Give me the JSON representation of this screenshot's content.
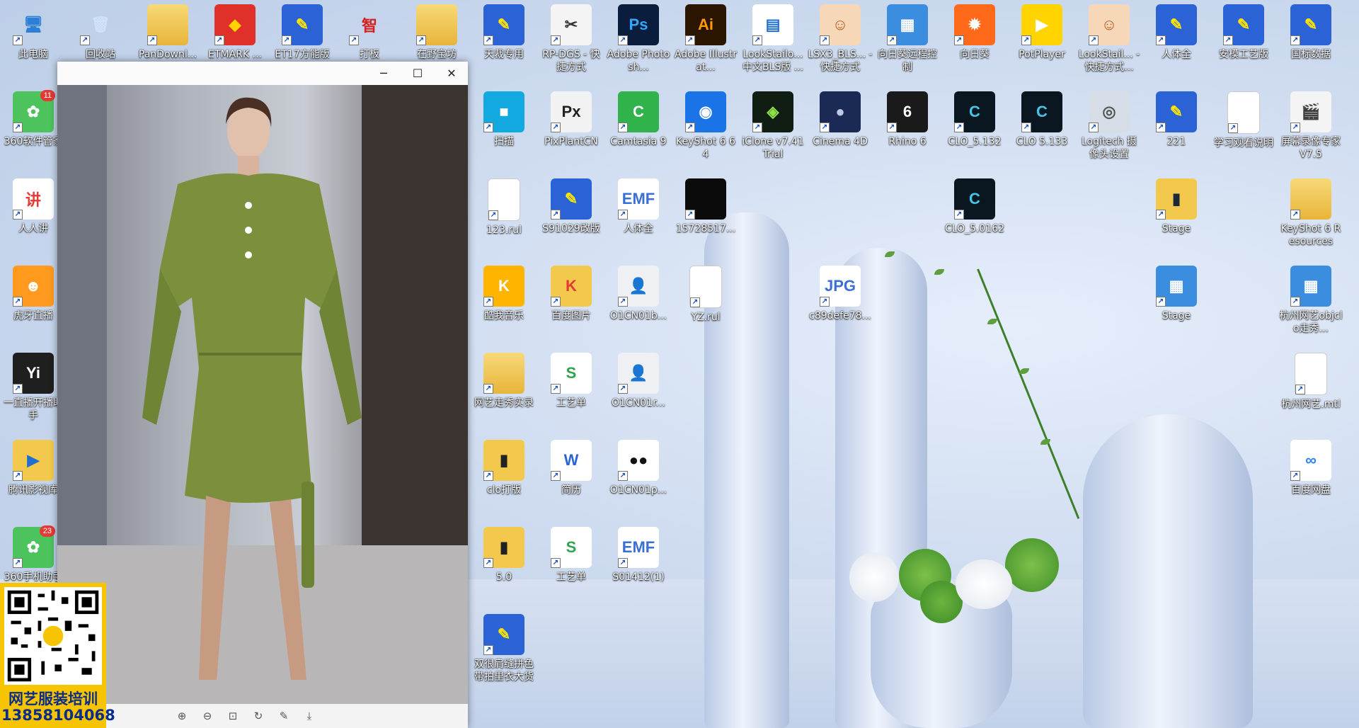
{
  "desktop": {
    "icons": [
      {
        "label": "此电脑",
        "glyph": "🖥",
        "bg": "#ffffff00",
        "fg": "#2d7fd6"
      },
      {
        "label": "回收站",
        "glyph": "🗑",
        "bg": "#ffffff00",
        "fg": "#cfe2f7"
      },
      {
        "label": "PanDownl...",
        "glyph": "",
        "bg": "#f2c94c",
        "fg": "#fff"
      },
      {
        "label": "ETMARK ...",
        "glyph": "◆",
        "bg": "#e0302a",
        "fg": "#ffd200"
      },
      {
        "label": "ET17方能版",
        "glyph": "✎",
        "bg": "#2b62d6",
        "fg": "#ffe600"
      },
      {
        "label": "打板",
        "glyph": "智",
        "bg": "#ffffff00",
        "fg": "#d81f1f"
      },
      {
        "label": "在野宝坊",
        "glyph": "",
        "bg": "#f2c94c",
        "fg": "#fff"
      },
      {
        "label": "天裁专用",
        "glyph": "✎",
        "bg": "#2b62d6",
        "fg": "#ffe600"
      },
      {
        "label": "RP-DGS - 快捷方式",
        "glyph": "✂",
        "bg": "#f4f4f4",
        "fg": "#333"
      },
      {
        "label": "Adobe Photosh...",
        "glyph": "Ps",
        "bg": "#0a1d3d",
        "fg": "#31a8ff"
      },
      {
        "label": "Adobe Illustrat...",
        "glyph": "Ai",
        "bg": "#2b1500",
        "fg": "#ff9a00"
      },
      {
        "label": "LookStailo... 中文BLS版 ...",
        "glyph": "▤",
        "bg": "#ffffff",
        "fg": "#1f6fd1"
      },
      {
        "label": "LSX3_BLS... - 快捷方式",
        "glyph": "☺",
        "bg": "#f6d7b8",
        "fg": "#b05a1c"
      },
      {
        "label": "向日葵远程控制",
        "glyph": "▦",
        "bg": "#3b8de0",
        "fg": "#fff"
      },
      {
        "label": "向日葵",
        "glyph": "✹",
        "bg": "#ff6a1a",
        "fg": "#fff"
      },
      {
        "label": "PotPlayer",
        "glyph": "▶",
        "bg": "#ffd400",
        "fg": "#fff"
      },
      {
        "label": "LookStail... - 快捷方式...",
        "glyph": "☺",
        "bg": "#f6d7b8",
        "fg": "#b05a1c"
      },
      {
        "label": "人体全",
        "glyph": "✎",
        "bg": "#2b62d6",
        "fg": "#ffe600"
      },
      {
        "label": "安模工艺版",
        "glyph": "✎",
        "bg": "#2b62d6",
        "fg": "#ffe600"
      },
      {
        "label": "国标数据",
        "glyph": "✎",
        "bg": "#2b62d6",
        "fg": "#ffe600"
      },
      {
        "label": "360软件管家",
        "glyph": "✿",
        "bg": "#4cc35d",
        "fg": "#fff",
        "badge": "11"
      },
      {
        "label": "扫描",
        "glyph": "■",
        "bg": "#12a9e0",
        "fg": "#fff"
      },
      {
        "label": "PixPlantCN",
        "glyph": "Px",
        "bg": "#f2f2f2",
        "fg": "#222"
      },
      {
        "label": "Camtasia 9",
        "glyph": "C",
        "bg": "#2fb34a",
        "fg": "#fff"
      },
      {
        "label": "KeyShot 6 64",
        "glyph": "◉",
        "bg": "#1b73e8",
        "fg": "#fff"
      },
      {
        "label": "iClone v7.41 Trial",
        "glyph": "◈",
        "bg": "#101d12",
        "fg": "#8ee34a"
      },
      {
        "label": "Cinema 4D",
        "glyph": "●",
        "bg": "#1b2a55",
        "fg": "#bfc9e6"
      },
      {
        "label": "Rhino 6",
        "glyph": "6",
        "bg": "#1a1a1a",
        "fg": "#fff"
      },
      {
        "label": "CLO_5.132",
        "glyph": "C",
        "bg": "#0a1720",
        "fg": "#44c6e8"
      },
      {
        "label": "CLO 5.133",
        "glyph": "C",
        "bg": "#0a1720",
        "fg": "#44c6e8"
      },
      {
        "label": "Logitech 摄像头设置",
        "glyph": "◎",
        "bg": "#d7dde6",
        "fg": "#555"
      },
      {
        "label": "221",
        "glyph": "✎",
        "bg": "#2b62d6",
        "fg": "#ffe600"
      },
      {
        "label": "学习观看说明",
        "glyph": "",
        "bg": "#ffffff",
        "fg": "#999"
      },
      {
        "label": "屏幕录像专家V7.5",
        "glyph": "🎬",
        "bg": "#f4f4f4",
        "fg": "#333"
      },
      {
        "label": "人人讲",
        "glyph": "讲",
        "bg": "#ffffff",
        "fg": "#e53935"
      },
      {
        "label": "123.rul",
        "glyph": "",
        "bg": "#ffffff",
        "fg": "#999"
      },
      {
        "label": "S91029改版",
        "glyph": "✎",
        "bg": "#2b62d6",
        "fg": "#ffe600"
      },
      {
        "label": "人体全",
        "glyph": "EMF",
        "bg": "#ffffff",
        "fg": "#3a6fd6"
      },
      {
        "label": "15728517...",
        "glyph": "",
        "bg": "#0b0b0b",
        "fg": "#fff"
      },
      {
        "label": "CLO_5.0162",
        "glyph": "C",
        "bg": "#0a1720",
        "fg": "#44c6e8"
      },
      {
        "label": "Stage",
        "glyph": "▮",
        "bg": "#f2c94c",
        "fg": "#1a2a3a"
      },
      {
        "label": "KeyShot 6 Resources",
        "glyph": "",
        "bg": "#f2c94c",
        "fg": "#fff"
      },
      {
        "label": "虎牙直播",
        "glyph": "☻",
        "bg": "#ff9a1f",
        "fg": "#fff"
      },
      {
        "label": "酷我音乐",
        "glyph": "K",
        "bg": "#ffb400",
        "fg": "#fff"
      },
      {
        "label": "百度图片",
        "glyph": "K",
        "bg": "#f2c94c",
        "fg": "#e53935"
      },
      {
        "label": "O1CN01b...",
        "glyph": "👤",
        "bg": "#eef0f3",
        "fg": "#666"
      },
      {
        "label": "YZ.rul",
        "glyph": "",
        "bg": "#ffffff",
        "fg": "#999"
      },
      {
        "label": "c89defe78...",
        "glyph": "JPG",
        "bg": "#ffffff",
        "fg": "#3a6fd6"
      },
      {
        "label": "Stage",
        "glyph": "▦",
        "bg": "#3b8de0",
        "fg": "#fff"
      },
      {
        "label": "杭州网艺objclo走秀...",
        "glyph": "▦",
        "bg": "#3b8de0",
        "fg": "#fff"
      },
      {
        "label": "一直播开播助手",
        "glyph": "Yi",
        "bg": "#1f1f1f",
        "fg": "#fff"
      },
      {
        "label": "网艺走秀实录",
        "glyph": "",
        "bg": "#f2c94c",
        "fg": "#fff"
      },
      {
        "label": "工艺单",
        "glyph": "S",
        "bg": "#ffffff",
        "fg": "#2fa44f"
      },
      {
        "label": "O1CN01r...",
        "glyph": "👤",
        "bg": "#eef0f3",
        "fg": "#666"
      },
      {
        "label": "杭州网艺.mtl",
        "glyph": "",
        "bg": "#ffffff",
        "fg": "#999"
      },
      {
        "label": "腾讯影视库",
        "glyph": "▶",
        "bg": "#f2c94c",
        "fg": "#1f6fd1"
      },
      {
        "label": "clo打版",
        "glyph": "▮",
        "bg": "#f2c94c",
        "fg": "#222"
      },
      {
        "label": "简历",
        "glyph": "W",
        "bg": "#ffffff",
        "fg": "#2b62d6"
      },
      {
        "label": "O1CN01p...",
        "glyph": "●●",
        "bg": "#ffffff",
        "fg": "#111"
      },
      {
        "label": "百度网盘",
        "glyph": "∞",
        "bg": "#ffffff",
        "fg": "#2b82f0"
      },
      {
        "label": "360手机助手",
        "glyph": "✿",
        "bg": "#4cc35d",
        "fg": "#fff",
        "badge": "23"
      },
      {
        "label": "5.0",
        "glyph": "▮",
        "bg": "#f2c94c",
        "fg": "#222"
      },
      {
        "label": "工艺单",
        "glyph": "S",
        "bg": "#ffffff",
        "fg": "#2fa44f"
      },
      {
        "label": "S01412(1)",
        "glyph": "EMF",
        "bg": "#ffffff",
        "fg": "#3a6fd6"
      },
      {
        "label": "双很肩缝拼色带拍里衣大货",
        "glyph": "✎",
        "bg": "#2b62d6",
        "fg": "#ffe600"
      }
    ]
  },
  "viewer": {
    "title": "",
    "min_icon": "─",
    "max_icon": "☐",
    "close_icon": "✕",
    "toolbar": [
      "⊕",
      "⊖",
      "⊡",
      "↻",
      "✎",
      "⤓"
    ]
  },
  "qr_ad": {
    "line1": "网艺服装培训",
    "line2": "13858104068"
  },
  "colors": {
    "accent": "#2b62d6",
    "ad_bg": "#f6c400",
    "ad_text": "#0a2d8c"
  }
}
